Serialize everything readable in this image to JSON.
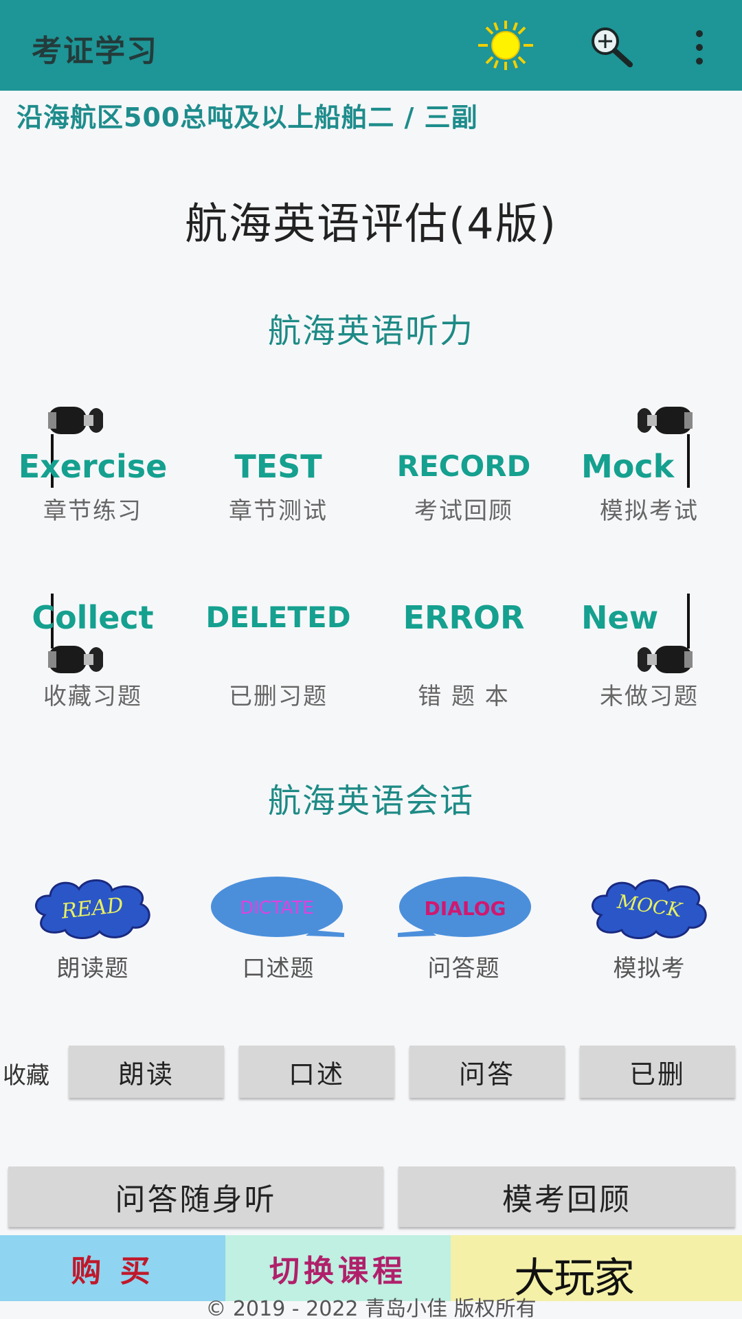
{
  "appbar": {
    "title": "考证学习",
    "icons": [
      "sun-icon",
      "search-icon",
      "more-vert-icon"
    ]
  },
  "course": {
    "subtitle": "沿海航区500总吨及以上船舶二 / 三副",
    "title": "航海英语评估(4版)"
  },
  "listening": {
    "section_title": "航海英语听力",
    "row1": [
      {
        "word": "Exercise",
        "label": "章节练习"
      },
      {
        "word": "TEST",
        "label": "章节测试"
      },
      {
        "word": "RECORD",
        "label": "考试回顾"
      },
      {
        "word": "Mock",
        "label": "模拟考试"
      }
    ],
    "row2": [
      {
        "word": "Collect",
        "label": "收藏习题"
      },
      {
        "word": "DELETED",
        "label": "已删习题"
      },
      {
        "word": "ERROR",
        "label": "错 题 本"
      },
      {
        "word": "New",
        "label": "未做习题"
      }
    ]
  },
  "speaking": {
    "section_title": "航海英语会话",
    "items": [
      {
        "word": "READ",
        "label": "朗读题"
      },
      {
        "word": "DICTATE",
        "label": "口述题"
      },
      {
        "word": "DIALOG",
        "label": "问答题"
      },
      {
        "word": "MOCK",
        "label": "模拟考"
      }
    ]
  },
  "favorites": {
    "label": "收藏",
    "buttons": [
      "朗读",
      "口述",
      "问答",
      "已删"
    ]
  },
  "actions": {
    "left": "问答随身听",
    "right": "模考回顾"
  },
  "bottom_bar": {
    "buy": "购 买",
    "switch": "切换课程",
    "watermark": "大玩家"
  },
  "footer": {
    "copyright": "© 2019 - 2022 青岛小佳 版权所有"
  },
  "colors": {
    "appbar": "#1e9596",
    "accent": "#15a08f",
    "buy_bg": "#8fd4f0",
    "switch_bg": "#bff0e2",
    "third_bg": "#f4f0a8"
  }
}
